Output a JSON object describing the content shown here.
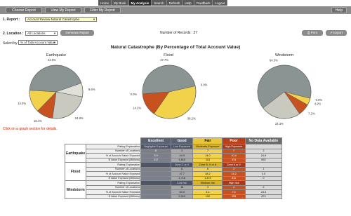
{
  "nav": {
    "items": [
      {
        "label": "Home",
        "active": false
      },
      {
        "label": "My Book",
        "active": false
      },
      {
        "label": "My Analysis",
        "active": true
      },
      {
        "label": "Search",
        "active": false
      },
      {
        "label": "Refresh",
        "active": false
      },
      {
        "label": "Help",
        "active": false
      },
      {
        "label": "Feedback",
        "active": false
      },
      {
        "label": "Logout",
        "active": false
      }
    ]
  },
  "tabs": {
    "items": [
      {
        "label": "Choose Report"
      },
      {
        "label": "View My Report"
      },
      {
        "label": "Filter My Report"
      }
    ],
    "help_label": "Help"
  },
  "controls": {
    "report_label": "1. Report :",
    "report_value": "Account Review-Natural Catastrophe",
    "location_label": "2. Location :",
    "location_value": "All Locations",
    "generate_label": "Generate Report",
    "records_text": "Number of Records : 27",
    "print_label": "Print",
    "export_label": "Export",
    "selectby_label": "Select by",
    "selectby_value": "% of Total Account Value"
  },
  "chart_title": "Natural Catastrophe (By Percentage of Total Account Value)",
  "chart_data": [
    {
      "type": "pie",
      "title": "Earthquake",
      "categories": [
        "Excellent",
        "Good",
        "Fair",
        "Poor",
        "No Data Available"
      ],
      "values": [
        44.9,
        8.6,
        24.8,
        10.4,
        14.0
      ],
      "labels": [
        "44.9%",
        "8.6%",
        "24.8%",
        "10.4%",
        "14.0%"
      ],
      "colors": [
        "#8a9493",
        "#e0e0d8",
        "#c9c9bf",
        "#c7521f",
        "#f2d24a"
      ]
    },
    {
      "type": "pie",
      "title": "Flood",
      "categories": [
        "Excellent",
        "Good",
        "Fair",
        "Poor",
        "No Data Available"
      ],
      "values": [
        47.7,
        0.0,
        38.2,
        14.2,
        0.0
      ],
      "labels": [
        "47.7%",
        "0.0%",
        "38.2%",
        "14.2%",
        "0.0%"
      ],
      "colors": [
        "#8a9493",
        "#e0e0d8",
        "#f2d24a",
        "#c7521f",
        "#c9c9bf"
      ]
    },
    {
      "type": "pie",
      "title": "Windstorm",
      "categories": [
        "Excellent",
        "Good",
        "Fair",
        "Poor",
        "No Data Available"
      ],
      "values": [
        64.3,
        0.0,
        4.2,
        7.2,
        24.3
      ],
      "labels": [
        "64.3%",
        "0.0%",
        "4.2%",
        "7.2%",
        "24.3%"
      ],
      "colors": [
        "#8a9493",
        "#e0e0d8",
        "#f2d24a",
        "#c7521f",
        "#c9c9bf"
      ]
    }
  ],
  "hint": "Click on a graph section for details.",
  "table": {
    "headers": [
      "Excellent",
      "Good",
      "Fair",
      "Poor",
      "No Data Available"
    ],
    "sections": [
      {
        "peril": "Earthquake",
        "rows": [
          {
            "label": "Rating Explanation",
            "cells": [
              "Negligible Exposure",
              "Low Exposure",
              "Moderate Exposure",
              "High Exposure",
              ""
            ]
          },
          {
            "label": "Number of Locations",
            "cells": [
              "8",
              "3",
              "7",
              "7",
              "2"
            ]
          },
          {
            "label": "% of Account Value Exposed",
            "cells": [
              "5.9",
              "44.9",
              "14.0",
              "10.4",
              "24.8"
            ]
          },
          {
            "label": "$ Value Exposed (Millions)",
            "cells": [
              "217",
              "1,615",
              "503",
              "374",
              "892"
            ]
          }
        ]
      },
      {
        "peril": "Flood",
        "rows": [
          {
            "label": "Rating Explanation",
            "cells": [
              "",
              "Zone C or X",
              "Zone B, X or A",
              "Zone A or V",
              ""
            ]
          },
          {
            "label": "Number of Locations",
            "cells": [
              "",
              "8",
              "6",
              "3",
              "1"
            ]
          },
          {
            "label": "% of Account Value Exposed",
            "cells": [
              "",
              "47.7",
              "38.2",
              "14.2",
              "0.0"
            ]
          },
          {
            "label": "$ Value Exposed (Millions)",
            "cells": [
              "",
              "1,716",
              "1,375",
              "511",
              "0"
            ]
          }
        ]
      },
      {
        "peril": "Windstorm",
        "rows": [
          {
            "label": "Rating Explanation",
            "cells": [
              "",
              "Low risk",
              "Medium risk",
              "High risk",
              ""
            ]
          },
          {
            "label": "Number of Locations",
            "cells": [
              "",
              "18",
              "3",
              "4",
              "2"
            ]
          },
          {
            "label": "% of Account Value Exposed",
            "cells": [
              "",
              "64.3",
              "4.2",
              "7.2",
              "24.3"
            ]
          },
          {
            "label": "$ Value Exposed (Millions)",
            "cells": [
              "",
              "2,313",
              "150",
              "259",
              "874"
            ]
          }
        ]
      }
    ]
  }
}
